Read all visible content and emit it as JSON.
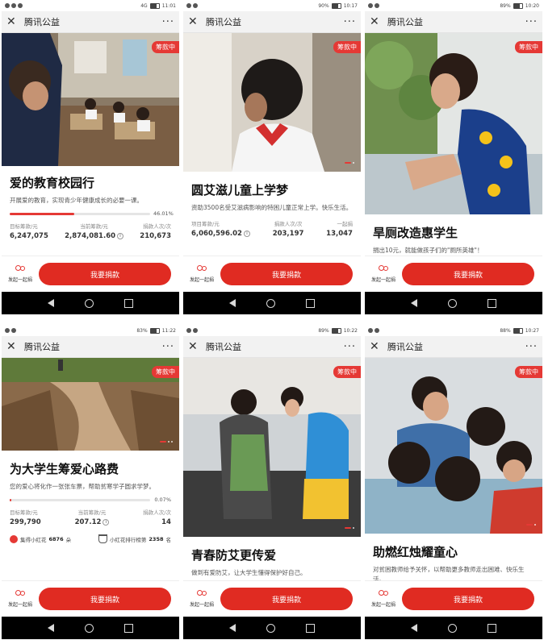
{
  "colors": {
    "accent": "#e53935",
    "donate": "#e02b22"
  },
  "app": {
    "title": "腾讯公益",
    "close_icon": "close-icon",
    "more_label": "···"
  },
  "buttons": {
    "donate": "我要捐款",
    "initiate": "发起一起捐"
  },
  "phones": [
    {
      "time": "11:01",
      "status": "4G",
      "badge": "筹款中",
      "title": "爱的教育校园行",
      "desc": "开展爱的教育，实现青少年健康成长的必要一课。",
      "progress_pct": "46.01%",
      "progress": 0.4601,
      "stats": [
        {
          "label": "目标筹款/元",
          "value": "6,247,075"
        },
        {
          "label": "当前筹款/元",
          "value": "2,874,081.60"
        },
        {
          "label": "捐款人次/次",
          "value": "210,673"
        }
      ]
    },
    {
      "time": "10:17",
      "status": "90%",
      "badge": "筹款中",
      "title": "圆艾滋儿童上学梦",
      "desc": "资助3500名受艾滋病影响的特困儿童正常上学。快乐生活。",
      "stats": [
        {
          "label": "项目筹款/元",
          "value": "6,060,596.02"
        },
        {
          "label": "捐款人次/次",
          "value": "203,197"
        },
        {
          "label": "一起捐",
          "value": "13,047"
        }
      ]
    },
    {
      "time": "10:20",
      "status": "89%",
      "badge": "筹款中",
      "title": "旱厕改造惠学生",
      "desc": "捐出10元，就能做孩子们的\"厕所英雄\"！"
    },
    {
      "time": "11:22",
      "status": "83%",
      "badge": "筹款中",
      "title": "为大学生筹爱心路费",
      "desc": "您的爱心将化作一张张车票，帮助贫寒学子圆求学梦。",
      "progress_pct": "0.07%",
      "progress": 0.0007,
      "stats": [
        {
          "label": "目标筹款/元",
          "value": "299,790"
        },
        {
          "label": "当前筹款/元",
          "value": "207.12"
        },
        {
          "label": "捐款人次/次",
          "value": "14"
        }
      ],
      "extra": {
        "flowers_label": "集得小红花",
        "flowers": "6876",
        "flowers_unit": "朵",
        "rank_label": "小红花排行榜第",
        "rank": "2358",
        "rank_unit": "名"
      }
    },
    {
      "time": "10:22",
      "status": "89%",
      "badge": "筹款中",
      "title": "青春防艾更传爱",
      "desc": "做到有爱防艾，让大学生懂得保护好自己。"
    },
    {
      "time": "10:27",
      "status": "88%",
      "badge": "筹款中",
      "title": "助燃红烛耀童心",
      "desc": "对贫困教师给予关怀，以帮助更多教师走出困难、快乐生活。"
    }
  ]
}
